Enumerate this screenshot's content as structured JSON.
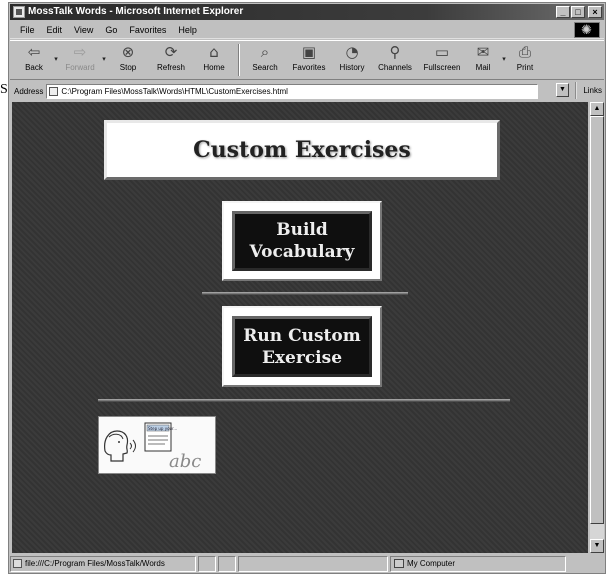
{
  "stray_char": "S",
  "window": {
    "title": "MossTalk Words - Microsoft Internet Explorer",
    "controls": {
      "minimize": "_",
      "maximize": "□",
      "close": "×"
    }
  },
  "menu": [
    "File",
    "Edit",
    "View",
    "Go",
    "Favorites",
    "Help"
  ],
  "toolbar": {
    "back": {
      "label": "Back",
      "icon": "back-arrow-icon",
      "glyph": "⇦"
    },
    "forward": {
      "label": "Forward",
      "icon": "forward-arrow-icon",
      "glyph": "⇨"
    },
    "stop": {
      "label": "Stop",
      "icon": "stop-icon",
      "glyph": "⊗"
    },
    "refresh": {
      "label": "Refresh",
      "icon": "refresh-icon",
      "glyph": "⟳"
    },
    "home": {
      "label": "Home",
      "icon": "home-icon",
      "glyph": "⌂"
    },
    "search": {
      "label": "Search",
      "icon": "search-icon",
      "glyph": "⌕"
    },
    "favorites": {
      "label": "Favorites",
      "icon": "favorites-icon",
      "glyph": "▣"
    },
    "history": {
      "label": "History",
      "icon": "history-icon",
      "glyph": "◔"
    },
    "channels": {
      "label": "Channels",
      "icon": "channels-icon",
      "glyph": "⚲"
    },
    "fullscreen": {
      "label": "Fullscreen",
      "icon": "fullscreen-icon",
      "glyph": "▭"
    },
    "mail": {
      "label": "Mail",
      "icon": "mail-icon",
      "glyph": "✉"
    },
    "print": {
      "label": "Print",
      "icon": "print-icon",
      "glyph": "⎙"
    },
    "dropdown_glyph": "▾"
  },
  "address": {
    "label": "Address",
    "value": "C:\\Program Files\\MossTalk\\Words\\HTML\\CustomExercises.html",
    "links_label": "Links"
  },
  "page": {
    "heading": "Custom Exercises",
    "build_button": "Build\nVocabulary",
    "run_button": "Run Custom\nExercise",
    "logo": {
      "sticker_text": "Step up your...",
      "script_text": "abc"
    }
  },
  "scrollbar": {
    "up": "▲",
    "down": "▼"
  },
  "status": {
    "text": "file:///C:/Program Files/MossTalk/Words",
    "zone": "My Computer"
  },
  "colors": {
    "page_background": "#353535",
    "button_face": "#0f0f0f",
    "title_bar": "#2a2a2a"
  }
}
